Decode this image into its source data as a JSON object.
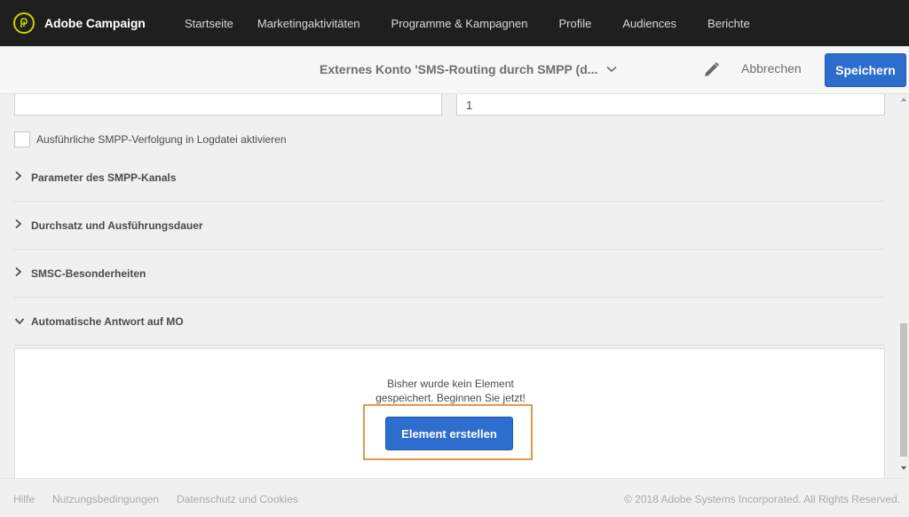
{
  "app": {
    "name": "Adobe Campaign"
  },
  "nav": {
    "items": [
      "Startseite",
      "Marketingaktivitäten",
      "Programme & Kampagnen",
      "Profile",
      "Audiences",
      "Berichte"
    ]
  },
  "header": {
    "title": "Externes Konto 'SMS-Routing durch SMPP (d...",
    "cancel_label": "Abbrechen",
    "save_label": "Speichern"
  },
  "form": {
    "field_left_value": "",
    "field_right_value": "1",
    "checkbox_label": "Ausführliche SMPP-Verfolgung in Logdatei aktivieren",
    "checkbox_checked": false
  },
  "sections": [
    {
      "label": "Parameter des SMPP-Kanals",
      "expanded": false
    },
    {
      "label": "Durchsatz und Ausführungsdauer",
      "expanded": false
    },
    {
      "label": "SMSC-Besonderheiten",
      "expanded": false
    },
    {
      "label": "Automatische Antwort auf MO",
      "expanded": true
    }
  ],
  "empty_state": {
    "line1": "Bisher wurde kein Element",
    "line2": "gespeichert. Beginnen Sie jetzt!",
    "button_label": "Element erstellen"
  },
  "footer": {
    "links": [
      "Hilfe",
      "Nutzungsbedingungen",
      "Datenschutz und Cookies"
    ],
    "copyright": "© 2018 Adobe Systems Incorporated. All Rights Reserved."
  },
  "colors": {
    "accent": "#2d6dce",
    "logo": "#c8d400",
    "highlight": "#e8964d",
    "topbar": "#1f1f1f"
  },
  "icons": {
    "brand": "adobe-campaign-logo-icon",
    "title_dropdown": "chevron-down-icon",
    "edit": "pencil-icon",
    "collapsed": "chevron-right-icon",
    "expanded": "chevron-down-icon"
  }
}
